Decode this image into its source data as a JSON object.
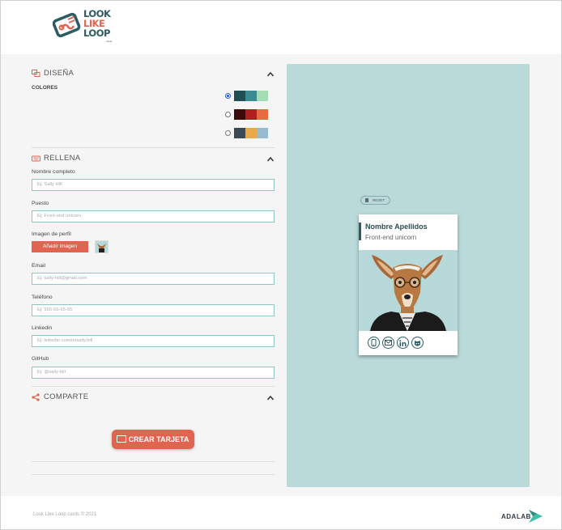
{
  "header": {
    "logo_lines": [
      "LOOK",
      "LIKE",
      "LOOP"
    ],
    "logo_small": "cards"
  },
  "design": {
    "title": "DISEÑA",
    "colors_label": "COLORES",
    "palettes": [
      {
        "selected": true,
        "colors": [
          "#1f4e55",
          "#3b8a92",
          "#a6dcb3"
        ]
      },
      {
        "selected": false,
        "colors": [
          "#3d0a0a",
          "#b11f1f",
          "#e86a3f"
        ]
      },
      {
        "selected": false,
        "colors": [
          "#3a4b55",
          "#e9a949",
          "#97bccf"
        ]
      }
    ]
  },
  "fill": {
    "title": "RELLENA",
    "fields": [
      {
        "label": "Nombre completo",
        "placeholder": "Ej: Sally Hill"
      },
      {
        "label": "Puesto",
        "placeholder": "Ej: Front-end unicorn"
      },
      {
        "label": "Email",
        "placeholder": "Ej: sally-hill@gmail.com"
      },
      {
        "label": "Teléfono",
        "placeholder": "Ej: 555-55-55-55"
      },
      {
        "label": "Linkedin",
        "placeholder": "Ej: linkedin.com/in/sally.hill"
      },
      {
        "label": "GitHub",
        "placeholder": "Ej: @sally-hill"
      }
    ],
    "image_label": "Imagen de perfil",
    "image_button": "Añadir imagen"
  },
  "share": {
    "title": "COMPARTE",
    "create_button": "CREAR TARJETA"
  },
  "preview": {
    "reset_label": "RESET",
    "card_name": "Nombre Apellidos",
    "card_job": "Front-end unicorn",
    "icons": [
      "phone-icon",
      "email-icon",
      "linkedin-icon",
      "github-icon"
    ]
  },
  "footer": {
    "copyright": "Look Like Loop cards © 2021",
    "brand": "ADALAB"
  },
  "colors": {
    "accent": "#e0644f",
    "primary": "#2d5b61",
    "preview_bg": "#bad9d9",
    "input_border": "#8fc6c8"
  }
}
